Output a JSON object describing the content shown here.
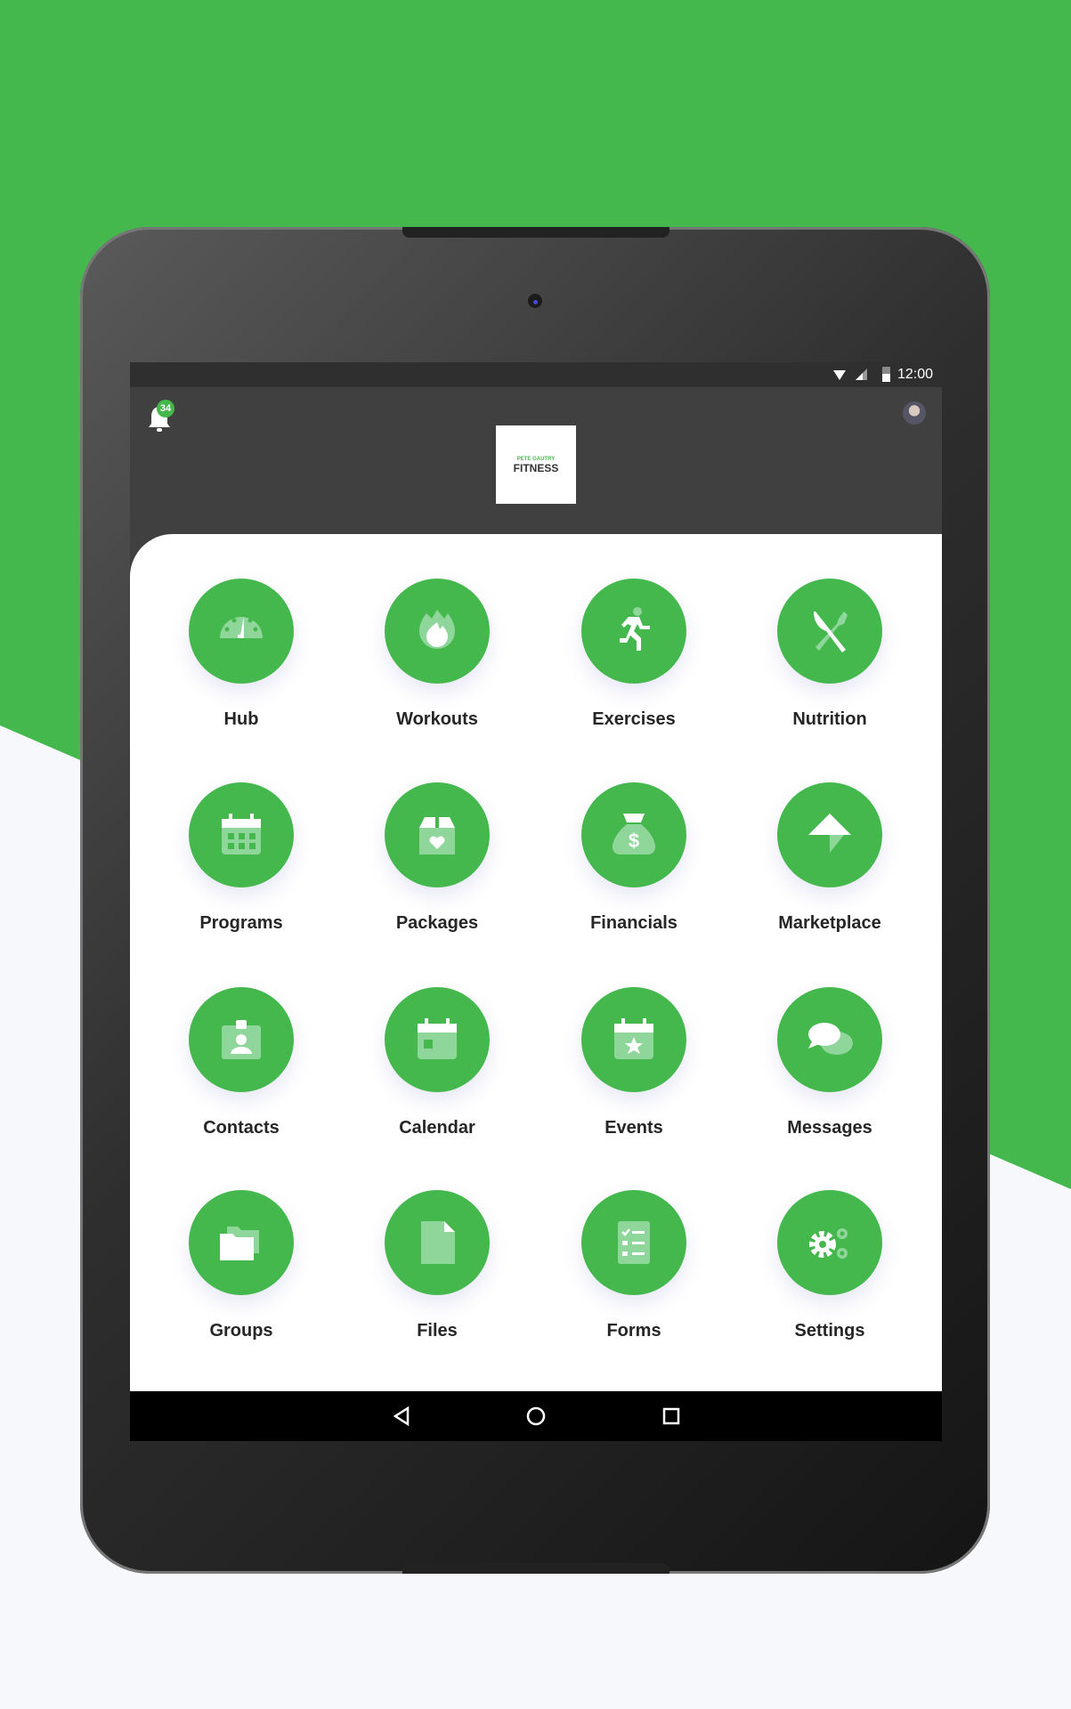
{
  "colors": {
    "brand_green": "#45b84d",
    "icon_light": "#8fd69a",
    "header_bg": "#404040"
  },
  "status_bar": {
    "time": "12:00",
    "icons": [
      "wifi-icon",
      "signal-icon",
      "battery-icon"
    ]
  },
  "header": {
    "notification_count": "34",
    "logo_text_small": "PETE GAUTRY",
    "logo_text_large": "FITNESS"
  },
  "menu": [
    {
      "label": "Hub",
      "icon": "dashboard-icon"
    },
    {
      "label": "Workouts",
      "icon": "flame-icon"
    },
    {
      "label": "Exercises",
      "icon": "running-icon"
    },
    {
      "label": "Nutrition",
      "icon": "utensils-icon"
    },
    {
      "label": "Programs",
      "icon": "calendar-grid-icon"
    },
    {
      "label": "Packages",
      "icon": "gift-box-icon"
    },
    {
      "label": "Financials",
      "icon": "money-bag-icon"
    },
    {
      "label": "Marketplace",
      "icon": "marketplace-icon"
    },
    {
      "label": "Contacts",
      "icon": "contact-card-icon"
    },
    {
      "label": "Calendar",
      "icon": "calendar-icon"
    },
    {
      "label": "Events",
      "icon": "calendar-star-icon"
    },
    {
      "label": "Messages",
      "icon": "chat-bubbles-icon"
    },
    {
      "label": "Groups",
      "icon": "folders-icon"
    },
    {
      "label": "Files",
      "icon": "file-icon"
    },
    {
      "label": "Forms",
      "icon": "checklist-icon"
    },
    {
      "label": "Settings",
      "icon": "gears-icon"
    }
  ],
  "nav_bar": [
    "back-icon",
    "home-icon",
    "recents-icon"
  ]
}
